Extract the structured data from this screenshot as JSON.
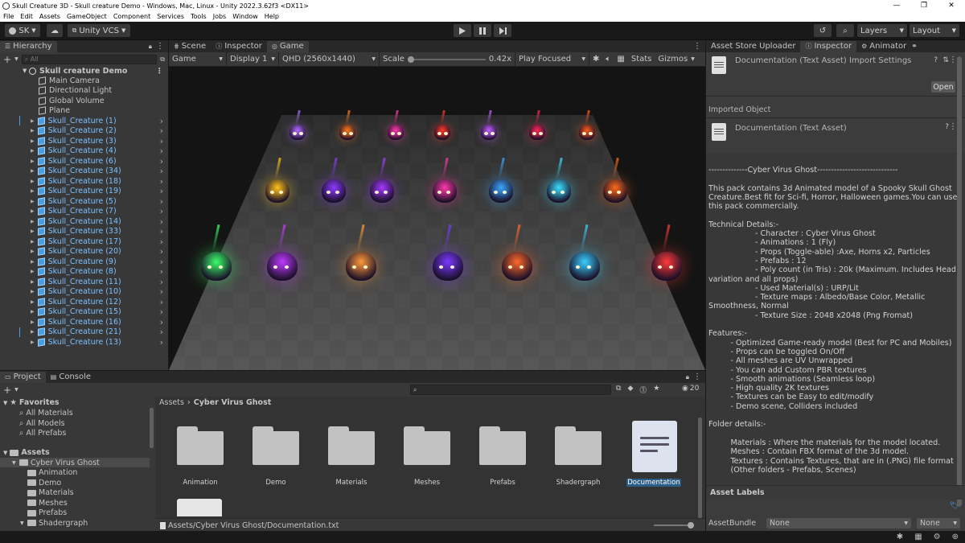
{
  "window": {
    "title": "Skull Creature 3D - Skull creature Demo - Windows, Mac, Linux - Unity 2022.3.62f3 <DX11>",
    "controls": [
      "—",
      "❐",
      "✕"
    ]
  },
  "menu": [
    "File",
    "Edit",
    "Assets",
    "GameObject",
    "Component",
    "Services",
    "Tools",
    "Jobs",
    "Window",
    "Help"
  ],
  "toolbar": {
    "account": "SK",
    "vcs": "Unity VCS",
    "layers": "Layers",
    "layout": "Layout"
  },
  "hierarchy": {
    "tab": "Hierarchy",
    "search_placeholder": "All",
    "scene": "Skull creature Demo",
    "items": [
      {
        "label": "Main Camera",
        "type": "gray"
      },
      {
        "label": "Directional Light",
        "type": "gray"
      },
      {
        "label": "Global Volume",
        "type": "gray"
      },
      {
        "label": "Plane",
        "type": "gray"
      },
      {
        "label": "Skull_Creature (1)",
        "type": "blue"
      },
      {
        "label": "Skull_Creature (2)",
        "type": "blue"
      },
      {
        "label": "Skull_Creature (3)",
        "type": "blue"
      },
      {
        "label": "Skull_Creature (4)",
        "type": "blue"
      },
      {
        "label": "Skull_Creature (6)",
        "type": "blue"
      },
      {
        "label": "Skull_Creature (34)",
        "type": "blue"
      },
      {
        "label": "Skull_Creature (18)",
        "type": "blue"
      },
      {
        "label": "Skull_Creature (19)",
        "type": "blue"
      },
      {
        "label": "Skull_Creature (5)",
        "type": "blue"
      },
      {
        "label": "Skull_Creature (7)",
        "type": "blue"
      },
      {
        "label": "Skull_Creature (14)",
        "type": "blue"
      },
      {
        "label": "Skull_Creature (33)",
        "type": "blue"
      },
      {
        "label": "Skull_Creature (17)",
        "type": "blue"
      },
      {
        "label": "Skull_Creature (20)",
        "type": "blue"
      },
      {
        "label": "Skull_Creature (9)",
        "type": "blue"
      },
      {
        "label": "Skull_Creature (8)",
        "type": "blue"
      },
      {
        "label": "Skull_Creature (11)",
        "type": "blue"
      },
      {
        "label": "Skull_Creature (10)",
        "type": "blue"
      },
      {
        "label": "Skull_Creature (12)",
        "type": "blue"
      },
      {
        "label": "Skull_Creature (15)",
        "type": "blue"
      },
      {
        "label": "Skull_Creature (16)",
        "type": "blue"
      },
      {
        "label": "Skull_Creature (21)",
        "type": "blue"
      },
      {
        "label": "Skull_Creature (13)",
        "type": "blue"
      }
    ]
  },
  "center_tabs": [
    "Scene",
    "Inspector",
    "Game"
  ],
  "game": {
    "mode": "Game",
    "display": "Display 1",
    "resolution": "QHD (2560x1440)",
    "scale_label": "Scale",
    "scale_value": "0.42x",
    "play_mode": "Play Focused",
    "stats": "Stats",
    "gizmos": "Gizmos"
  },
  "right_tabs": [
    "Asset Store Uploader",
    "Inspector",
    "Animator"
  ],
  "inspector": {
    "header": "Documentation (Text Asset) Import Settings",
    "open_button": "Open",
    "imported_object": "Imported Object",
    "asset_title": "Documentation (Text Asset)",
    "text": "--------------Cyber Virus Ghost-----------------------------\n\nThis pack contains 3d Animated model of a Spooky Skull Ghost Creature.Best fit for Sci-fi, Horror, Halloween games.You can use this pack commercially.\n\nTechnical Details:-\n                   - Character : Cyber Virus Ghost\n                   - Animations : 1 (Fly)\n                   - Props (Toggle-able) :Axe, Horns x2, Particles\n                   - Prefabs : 12\n                   - Poly count (in Tris) : 20k (Maximum. Includes Head variation and all props)\n                   - Used Material(s) : URP/Lit\n                   - Texture maps : Albedo/Base Color, Metallic Smoothness, Normal\n                   - Texture Size : 2048 x2048 (Png Fromat)\n\nFeatures:-\n         - Optimized Game-ready model (Best for PC and Mobiles)\n         - Props can be toggled On/Off\n         - All meshes are UV Unwrapped\n         - You can add Custom PBR textures\n         - Smooth animations (Seamless loop)\n         - High quality 2K textures\n         - Textures can be Easy to edit/modify\n         - Demo scene, Colliders included\n\nFolder details:-\n\n         Materials : Where the materials for the model located.\n         Meshes : Contain FBX format of the 3d model.\n         Textures : Contains Textures, that are in (.PNG) file format\n         (Other folders - Prefabs, Scenes)",
    "asset_labels": "Asset Labels",
    "assetbundle_label": "AssetBundle",
    "assetbundle_value": "None",
    "assetbundle_variant": "None"
  },
  "project": {
    "tabs": [
      "Project",
      "Console"
    ],
    "favorites": "Favorites",
    "fav_items": [
      "All Materials",
      "All Models",
      "All Prefabs"
    ],
    "assets_root": "Assets",
    "tree": [
      "Cyber Virus Ghost",
      "Animation",
      "Demo",
      "Materials",
      "Meshes",
      "Prefabs",
      "Shadergraph"
    ],
    "breadcrumb_root": "Assets",
    "breadcrumb_current": "Cyber Virus Ghost",
    "badge_count": "20",
    "items": [
      "Animation",
      "Demo",
      "Materials",
      "Meshes",
      "Prefabs",
      "Shadergraph",
      "Documentation"
    ],
    "selected_path": "Assets/Cyber Virus Ghost/Documentation.txt"
  },
  "colors": {
    "selection": "#2c5d87",
    "highlight_text": "#7cc1ff",
    "panel": "#383838"
  }
}
